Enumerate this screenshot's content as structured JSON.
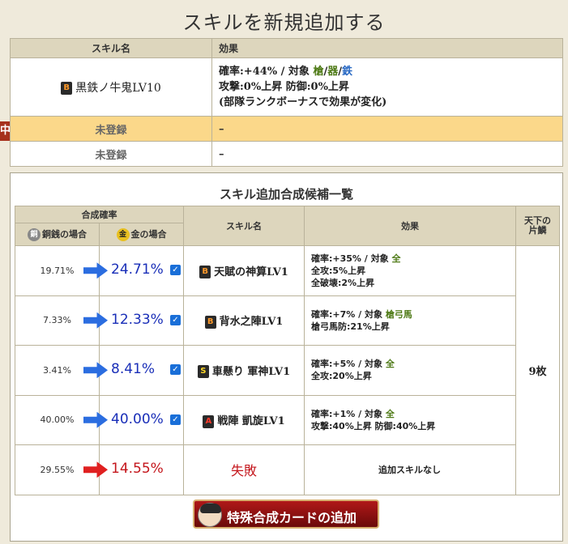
{
  "title": "スキルを新規追加する",
  "skills_table": {
    "headers": [
      "スキル名",
      "効果"
    ],
    "current_skill": {
      "grade": "B",
      "name": "黒鉄ノ牛鬼LV10",
      "effect_line1_prefix": "確率:+44% / 対象",
      "targets": [
        "槍",
        "器",
        "鉄"
      ],
      "effect_line2": "攻撃:0%上昇 防御:0%上昇",
      "effect_line3": "(部隊ランクボーナスで効果が変化)"
    },
    "empty_slots": [
      {
        "name": "未登録",
        "effect": "–",
        "active": true
      },
      {
        "name": "未登録",
        "effect": "–",
        "active": false
      }
    ],
    "marker_label": "中"
  },
  "candidates_panel": {
    "title": "スキル追加合成候補一覧",
    "header_rate": "合成確率",
    "header_copper": "銅銭の場合",
    "header_gold": "金の場合",
    "coin_copper": "銅",
    "coin_gold": "金",
    "header_skill": "スキル名",
    "header_effect": "効果",
    "header_tenka": "天下の片鱗",
    "tenka_value": "9枚",
    "rows": [
      {
        "copper": "19.71%",
        "gold": "24.71%",
        "grade": "B",
        "name": "天賦の神算LV1",
        "eff1": "確率:+35% / 対象",
        "eff1_target": "全",
        "eff2": "全攻:5%上昇",
        "eff3": "全破壊:2%上昇"
      },
      {
        "copper": "7.33%",
        "gold": "12.33%",
        "grade": "B",
        "name": "背水之陣LV1",
        "eff1": "確率:+7% / 対象",
        "eff1_target": "槍弓馬",
        "eff2": "槍弓馬防:21%上昇",
        "eff3": ""
      },
      {
        "copper": "3.41%",
        "gold": "8.41%",
        "grade": "S",
        "name": "車懸り 軍神LV1",
        "eff1": "確率:+5% / 対象",
        "eff1_target": "全",
        "eff2": "全攻:20%上昇",
        "eff3": ""
      },
      {
        "copper": "40.00%",
        "gold": "40.00%",
        "grade": "A",
        "name": "戦陣 凱旋LV1",
        "eff1": "確率:+1% / 対象",
        "eff1_target": "全",
        "eff2": "攻撃:40%上昇 防御:40%上昇",
        "eff3": ""
      }
    ],
    "fail_row": {
      "copper": "29.55%",
      "gold": "14.55%",
      "name": "失敗",
      "effect": "追加スキルなし"
    },
    "special_button": "特殊合成カードの追加"
  },
  "colors": {
    "blue_rate": "#1a2fb8",
    "red_rate": "#c4161c",
    "active_row": "#fbd88a",
    "header_bg": "#ddd6bd"
  }
}
